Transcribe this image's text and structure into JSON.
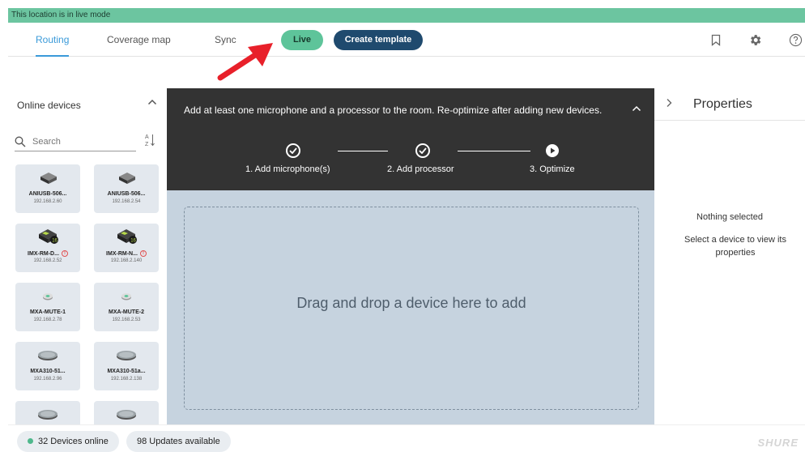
{
  "banner": {
    "text": "This location is in live mode"
  },
  "nav": {
    "tabs": [
      {
        "label": "Routing",
        "active": true
      },
      {
        "label": "Coverage map",
        "active": false
      },
      {
        "label": "Sync",
        "active": false
      }
    ],
    "live_label": "Live",
    "create_template_label": "Create template",
    "icons": [
      "bookmark-icon",
      "gear-icon",
      "help-icon"
    ]
  },
  "sidebar": {
    "title": "Online devices",
    "search_placeholder": "Search",
    "devices": [
      {
        "name": "ANIUSB-506...",
        "ip": "192.168.2.60",
        "icon": "aniusb-icon",
        "warning": false
      },
      {
        "name": "ANIUSB-506...",
        "ip": "192.168.2.54",
        "icon": "aniusb-icon",
        "warning": false
      },
      {
        "name": "IMX-RM-D...",
        "ip": "192.168.2.52",
        "icon": "imx-rm-icon",
        "warning": true
      },
      {
        "name": "IMX-RM-N...",
        "ip": "192.168.2.140",
        "icon": "imx-rm-icon",
        "warning": true
      },
      {
        "name": "MXA-MUTE-1",
        "ip": "192.168.2.78",
        "icon": "mute-button-icon",
        "warning": false
      },
      {
        "name": "MXA-MUTE-2",
        "ip": "192.168.2.53",
        "icon": "mute-button-icon",
        "warning": false
      },
      {
        "name": "MXA310-51...",
        "ip": "192.168.2.96",
        "icon": "table-mic-icon",
        "warning": false
      },
      {
        "name": "MXA310-51a...",
        "ip": "192.168.2.138",
        "icon": "table-mic-icon",
        "warning": false
      },
      {
        "name": "",
        "ip": "",
        "icon": "table-mic-icon",
        "warning": false
      },
      {
        "name": "",
        "ip": "",
        "icon": "table-mic-icon",
        "warning": false
      }
    ]
  },
  "main": {
    "instruction": "Add at least one microphone and a processor to the room. Re-optimize after adding new devices.",
    "steps": [
      {
        "label": "1. Add microphone(s)",
        "status": "done"
      },
      {
        "label": "2. Add processor",
        "status": "done"
      },
      {
        "label": "3. Optimize",
        "status": "current"
      }
    ],
    "drop_text": "Drag and drop a device here to add"
  },
  "properties": {
    "title": "Properties",
    "empty_title": "Nothing selected",
    "empty_hint": "Select a device to view its properties"
  },
  "footer": {
    "devices_online": "32 Devices online",
    "updates": "98 Updates available",
    "brand": "SHURE"
  },
  "colors": {
    "live_green": "#5ec49a",
    "banner_green": "#6cc5a0",
    "template_navy": "#1f4a6e",
    "active_tab_blue": "#3a9ad9",
    "annotation_red": "#e8202a"
  }
}
